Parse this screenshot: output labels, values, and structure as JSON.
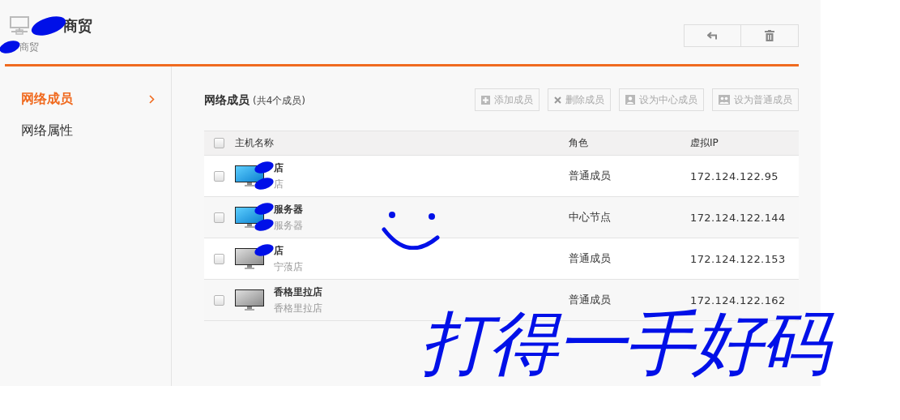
{
  "header": {
    "title": "商贸",
    "subtitle": "商贸",
    "title_redacted": true,
    "subtitle_redacted": true
  },
  "sidebar": {
    "items": [
      {
        "label": "网络成员",
        "selected": true
      },
      {
        "label": "网络属性",
        "selected": false
      }
    ]
  },
  "members": {
    "heading": "网络成员",
    "count": "(共4个成员)",
    "toolbar": [
      {
        "label": "添加成员",
        "kind": "add"
      },
      {
        "label": "删除成员",
        "kind": "delete"
      },
      {
        "label": "设为中心成员",
        "kind": "center"
      },
      {
        "label": "设为普通成员",
        "kind": "normal"
      }
    ],
    "select_all_checked": false,
    "columns": [
      "主机名称",
      "角色",
      "虚拟IP"
    ],
    "rows": [
      {
        "name": "店",
        "alias": "店",
        "name_redacted": true,
        "alias_redacted": true,
        "online": true,
        "checked": false,
        "role": "普通成员",
        "ip": "172.124.122.95"
      },
      {
        "name": "服务器",
        "alias": "服务器",
        "name_redacted": true,
        "alias_redacted": true,
        "online": true,
        "checked": false,
        "role": "中心节点",
        "ip": "172.124.122.144"
      },
      {
        "name": "店",
        "alias": "宁蒗店",
        "name_redacted": true,
        "alias_redacted": false,
        "online": false,
        "checked": false,
        "role": "普通成员",
        "ip": "172.124.122.153"
      },
      {
        "name": "香格里拉店",
        "alias": "香格里拉店",
        "name_redacted": false,
        "alias_redacted": false,
        "online": false,
        "checked": false,
        "role": "普通成员",
        "ip": "172.124.122.162"
      }
    ]
  },
  "annotation": {
    "text": "打得一手好码"
  }
}
